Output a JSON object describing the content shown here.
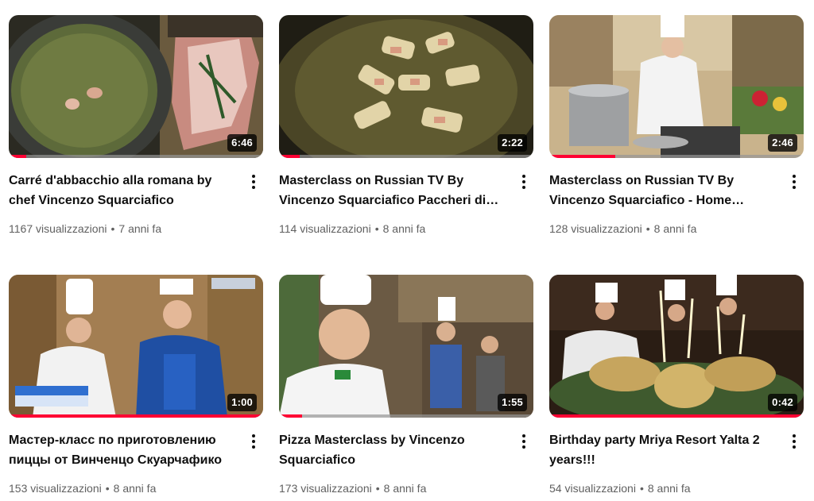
{
  "videos": [
    {
      "title": "Carré d'abbacchio alla romana by chef Vincenzo Squarciafico",
      "views": "1167 visualizzazioni",
      "age": "7 anni fa",
      "duration": "6:46",
      "watched_progress": 0.07,
      "thumbnail_icon": "pan-with-lamb-thumbnail"
    },
    {
      "title": "Masterclass on Russian TV By Vincenzo Squarciafico Paccheri di…",
      "views": "114 visualizzazioni",
      "age": "8 anni fa",
      "duration": "2:22",
      "watched_progress": 0.08,
      "thumbnail_icon": "frying-pasta-thumbnail"
    },
    {
      "title": "Masterclass on Russian TV By Vincenzo Squarciafico - Home…",
      "views": "128 visualizzazioni",
      "age": "8 anni fa",
      "duration": "2:46",
      "watched_progress": 0.26,
      "thumbnail_icon": "chef-cooking-pot-thumbnail"
    },
    {
      "title": "Мастер-класс по приготовлению пиццы от Винченцо Скуарчафико",
      "views": "153 visualizzazioni",
      "age": "8 anni fa",
      "duration": "1:00",
      "watched_progress": 1.0,
      "thumbnail_icon": "two-chefs-tv-thumbnail"
    },
    {
      "title": "Pizza Masterclass by Vincenzo Squarciafico",
      "views": "173 visualizzazioni",
      "age": "8 anni fa",
      "duration": "1:55",
      "watched_progress": 0.09,
      "thumbnail_icon": "chef-portrait-thumbnail"
    },
    {
      "title": "Birthday party Mriya Resort Yalta 2 years!!!",
      "views": "54 visualizzazioni",
      "age": "8 anni fa",
      "duration": "0:42",
      "watched_progress": 1.0,
      "thumbnail_icon": "birthday-cake-sparklers-thumbnail"
    }
  ],
  "separator": "•",
  "colors": {
    "progress": "#ff0033",
    "meta_text": "#606060",
    "title_text": "#0f0f0f"
  }
}
